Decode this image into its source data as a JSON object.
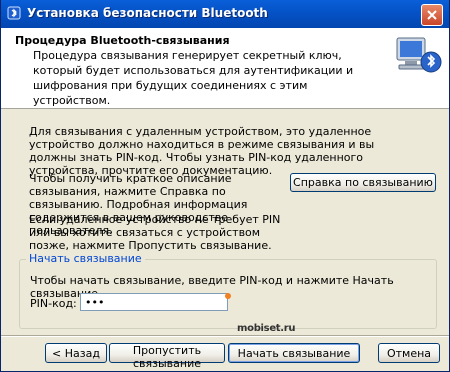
{
  "window": {
    "title": "Установка безопасности Bluetooth"
  },
  "header": {
    "title": "Процедура Bluetooth-связывания",
    "description": "Процедура связывания генерирует секретный ключ, который будет использоваться для аутентификации и шифрования при будущих соединениях с этим устройством."
  },
  "body": {
    "paragraph1": "Для связывания с удаленным устройством, это удаленное устройство должно находиться в режиме связывания и вы должны знать PIN-код.  Чтобы узнать PIN-код удаленного устройства, прочтите его документацию.",
    "paragraph2": "Чтобы получить краткое описание связывания, нажмите Справка по связыванию.  Подробная информация содержится в вашем руководстве пользователя.",
    "help_button": "Справка по связыванию",
    "paragraph3": "Если удаленное устройство не требует PIN или вы хотите связаться с устройством позже, нажмите Пропустить связывание."
  },
  "group": {
    "label": "Начать связывание",
    "text": "Чтобы начать связывание, введите PIN-код и нажмите Начать связывание.",
    "pin_label": "PIN-код:",
    "pin_value": "•••"
  },
  "watermark": {
    "text": "mobiset.ru"
  },
  "footer": {
    "back": "< Назад",
    "skip": "Пропустить связывание",
    "start": "Начать связывание",
    "cancel": "Отмена"
  },
  "colors": {
    "titlebar": "#0553c8",
    "group_label": "#0046d5",
    "close": "#c9452a"
  },
  "icons": [
    "bluetooth-app-icon",
    "close-icon",
    "bluetooth-computer-icon"
  ]
}
